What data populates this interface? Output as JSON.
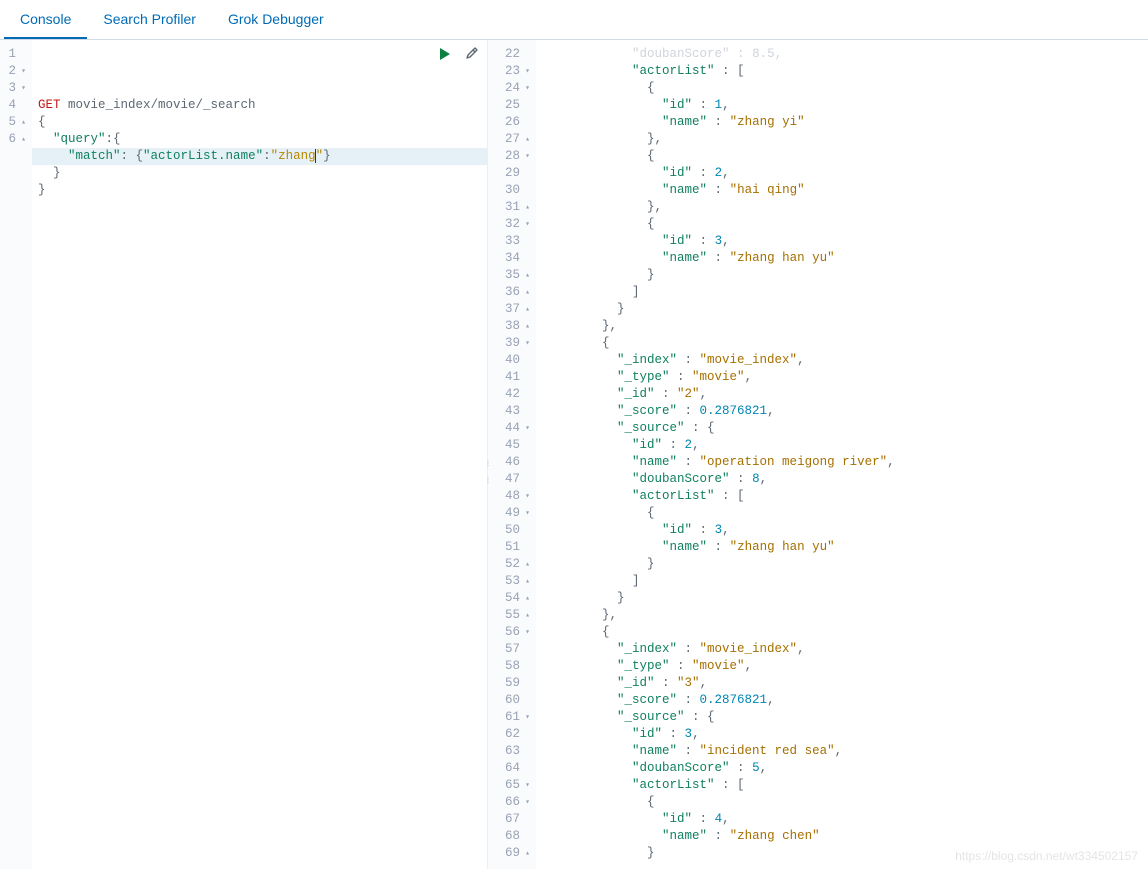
{
  "tabs": {
    "console": "Console",
    "searchProfiler": "Search Profiler",
    "grokDebugger": "Grok Debugger"
  },
  "actions": {
    "run": "play-icon",
    "tools": "wrench-icon"
  },
  "request": {
    "method": "GET",
    "path": "movie_index/movie/_search",
    "lines": [
      {
        "n": 1,
        "fold": "",
        "segs": [
          {
            "t": "GET ",
            "c": "kw"
          },
          {
            "t": "movie_index/movie/_search",
            "c": "path"
          }
        ]
      },
      {
        "n": 2,
        "fold": "▾",
        "segs": [
          {
            "t": "{",
            "c": "brace"
          }
        ]
      },
      {
        "n": 3,
        "fold": "▾",
        "segs": [
          {
            "t": "  ",
            "c": ""
          },
          {
            "t": "\"query\"",
            "c": "key"
          },
          {
            "t": ":{",
            "c": "punct"
          }
        ]
      },
      {
        "n": 4,
        "fold": "",
        "hl": true,
        "segs": [
          {
            "t": "    ",
            "c": ""
          },
          {
            "t": "\"match\"",
            "c": "key"
          },
          {
            "t": ": {",
            "c": "punct"
          },
          {
            "t": "\"actorList.name\"",
            "c": "key"
          },
          {
            "t": ":",
            "c": "punct"
          },
          {
            "t": "\"zhang",
            "c": "str"
          },
          {
            "t": "|",
            "c": "cursorchar"
          },
          {
            "t": "\"",
            "c": "str"
          },
          {
            "t": "}",
            "c": "punct"
          }
        ]
      },
      {
        "n": 5,
        "fold": "▴",
        "segs": [
          {
            "t": "  }",
            "c": "brace"
          }
        ]
      },
      {
        "n": 6,
        "fold": "▴",
        "segs": [
          {
            "t": "}",
            "c": "brace"
          }
        ]
      }
    ]
  },
  "response": {
    "lines": [
      {
        "n": 22,
        "fold": "",
        "segs": [
          {
            "t": "            ",
            "c": ""
          },
          {
            "t": "\"doubanScore\"",
            "c": "key tr"
          },
          {
            "t": " : ",
            "c": "punct tr"
          },
          {
            "t": "8.5",
            "c": "num tr"
          },
          {
            "t": ",",
            "c": "punct tr"
          }
        ],
        "truncated": true
      },
      {
        "n": 23,
        "fold": "▾",
        "segs": [
          {
            "t": "            ",
            "c": ""
          },
          {
            "t": "\"actorList\"",
            "c": "key"
          },
          {
            "t": " : [",
            "c": "punct"
          }
        ]
      },
      {
        "n": 24,
        "fold": "▾",
        "segs": [
          {
            "t": "              {",
            "c": "punct"
          }
        ]
      },
      {
        "n": 25,
        "fold": "",
        "segs": [
          {
            "t": "                ",
            "c": ""
          },
          {
            "t": "\"id\"",
            "c": "key"
          },
          {
            "t": " : ",
            "c": "punct"
          },
          {
            "t": "1",
            "c": "num"
          },
          {
            "t": ",",
            "c": "punct"
          }
        ]
      },
      {
        "n": 26,
        "fold": "",
        "segs": [
          {
            "t": "                ",
            "c": ""
          },
          {
            "t": "\"name\"",
            "c": "key"
          },
          {
            "t": " : ",
            "c": "punct"
          },
          {
            "t": "\"zhang yi\"",
            "c": "strv"
          }
        ]
      },
      {
        "n": 27,
        "fold": "▴",
        "segs": [
          {
            "t": "              },",
            "c": "punct"
          }
        ]
      },
      {
        "n": 28,
        "fold": "▾",
        "segs": [
          {
            "t": "              {",
            "c": "punct"
          }
        ]
      },
      {
        "n": 29,
        "fold": "",
        "segs": [
          {
            "t": "                ",
            "c": ""
          },
          {
            "t": "\"id\"",
            "c": "key"
          },
          {
            "t": " : ",
            "c": "punct"
          },
          {
            "t": "2",
            "c": "num"
          },
          {
            "t": ",",
            "c": "punct"
          }
        ]
      },
      {
        "n": 30,
        "fold": "",
        "segs": [
          {
            "t": "                ",
            "c": ""
          },
          {
            "t": "\"name\"",
            "c": "key"
          },
          {
            "t": " : ",
            "c": "punct"
          },
          {
            "t": "\"hai qing\"",
            "c": "strv"
          }
        ]
      },
      {
        "n": 31,
        "fold": "▴",
        "segs": [
          {
            "t": "              },",
            "c": "punct"
          }
        ]
      },
      {
        "n": 32,
        "fold": "▾",
        "segs": [
          {
            "t": "              {",
            "c": "punct"
          }
        ]
      },
      {
        "n": 33,
        "fold": "",
        "segs": [
          {
            "t": "                ",
            "c": ""
          },
          {
            "t": "\"id\"",
            "c": "key"
          },
          {
            "t": " : ",
            "c": "punct"
          },
          {
            "t": "3",
            "c": "num"
          },
          {
            "t": ",",
            "c": "punct"
          }
        ]
      },
      {
        "n": 34,
        "fold": "",
        "segs": [
          {
            "t": "                ",
            "c": ""
          },
          {
            "t": "\"name\"",
            "c": "key"
          },
          {
            "t": " : ",
            "c": "punct"
          },
          {
            "t": "\"zhang han yu\"",
            "c": "strv"
          }
        ]
      },
      {
        "n": 35,
        "fold": "▴",
        "segs": [
          {
            "t": "              }",
            "c": "punct"
          }
        ]
      },
      {
        "n": 36,
        "fold": "▴",
        "segs": [
          {
            "t": "            ]",
            "c": "punct"
          }
        ]
      },
      {
        "n": 37,
        "fold": "▴",
        "segs": [
          {
            "t": "          }",
            "c": "punct"
          }
        ]
      },
      {
        "n": 38,
        "fold": "▴",
        "segs": [
          {
            "t": "        },",
            "c": "punct"
          }
        ]
      },
      {
        "n": 39,
        "fold": "▾",
        "segs": [
          {
            "t": "        {",
            "c": "punct"
          }
        ]
      },
      {
        "n": 40,
        "fold": "",
        "segs": [
          {
            "t": "          ",
            "c": ""
          },
          {
            "t": "\"_index\"",
            "c": "key"
          },
          {
            "t": " : ",
            "c": "punct"
          },
          {
            "t": "\"movie_index\"",
            "c": "strv"
          },
          {
            "t": ",",
            "c": "punct"
          }
        ]
      },
      {
        "n": 41,
        "fold": "",
        "segs": [
          {
            "t": "          ",
            "c": ""
          },
          {
            "t": "\"_type\"",
            "c": "key"
          },
          {
            "t": " : ",
            "c": "punct"
          },
          {
            "t": "\"movie\"",
            "c": "strv"
          },
          {
            "t": ",",
            "c": "punct"
          }
        ]
      },
      {
        "n": 42,
        "fold": "",
        "segs": [
          {
            "t": "          ",
            "c": ""
          },
          {
            "t": "\"_id\"",
            "c": "key"
          },
          {
            "t": " : ",
            "c": "punct"
          },
          {
            "t": "\"2\"",
            "c": "strv"
          },
          {
            "t": ",",
            "c": "punct"
          }
        ]
      },
      {
        "n": 43,
        "fold": "",
        "segs": [
          {
            "t": "          ",
            "c": ""
          },
          {
            "t": "\"_score\"",
            "c": "key"
          },
          {
            "t": " : ",
            "c": "punct"
          },
          {
            "t": "0.2876821",
            "c": "num"
          },
          {
            "t": ",",
            "c": "punct"
          }
        ]
      },
      {
        "n": 44,
        "fold": "▾",
        "segs": [
          {
            "t": "          ",
            "c": ""
          },
          {
            "t": "\"_source\"",
            "c": "key"
          },
          {
            "t": " : {",
            "c": "punct"
          }
        ]
      },
      {
        "n": 45,
        "fold": "",
        "segs": [
          {
            "t": "            ",
            "c": ""
          },
          {
            "t": "\"id\"",
            "c": "key"
          },
          {
            "t": " : ",
            "c": "punct"
          },
          {
            "t": "2",
            "c": "num"
          },
          {
            "t": ",",
            "c": "punct"
          }
        ]
      },
      {
        "n": 46,
        "fold": "",
        "segs": [
          {
            "t": "            ",
            "c": ""
          },
          {
            "t": "\"name\"",
            "c": "key"
          },
          {
            "t": " : ",
            "c": "punct"
          },
          {
            "t": "\"operation meigong river\"",
            "c": "strv"
          },
          {
            "t": ",",
            "c": "punct"
          }
        ]
      },
      {
        "n": 47,
        "fold": "",
        "segs": [
          {
            "t": "            ",
            "c": ""
          },
          {
            "t": "\"doubanScore\"",
            "c": "key"
          },
          {
            "t": " : ",
            "c": "punct"
          },
          {
            "t": "8",
            "c": "num"
          },
          {
            "t": ",",
            "c": "punct"
          }
        ]
      },
      {
        "n": 48,
        "fold": "▾",
        "segs": [
          {
            "t": "            ",
            "c": ""
          },
          {
            "t": "\"actorList\"",
            "c": "key"
          },
          {
            "t": " : [",
            "c": "punct"
          }
        ]
      },
      {
        "n": 49,
        "fold": "▾",
        "segs": [
          {
            "t": "              {",
            "c": "punct"
          }
        ]
      },
      {
        "n": 50,
        "fold": "",
        "segs": [
          {
            "t": "                ",
            "c": ""
          },
          {
            "t": "\"id\"",
            "c": "key"
          },
          {
            "t": " : ",
            "c": "punct"
          },
          {
            "t": "3",
            "c": "num"
          },
          {
            "t": ",",
            "c": "punct"
          }
        ]
      },
      {
        "n": 51,
        "fold": "",
        "segs": [
          {
            "t": "                ",
            "c": ""
          },
          {
            "t": "\"name\"",
            "c": "key"
          },
          {
            "t": " : ",
            "c": "punct"
          },
          {
            "t": "\"zhang han yu\"",
            "c": "strv"
          }
        ]
      },
      {
        "n": 52,
        "fold": "▴",
        "segs": [
          {
            "t": "              }",
            "c": "punct"
          }
        ]
      },
      {
        "n": 53,
        "fold": "▴",
        "segs": [
          {
            "t": "            ]",
            "c": "punct"
          }
        ]
      },
      {
        "n": 54,
        "fold": "▴",
        "segs": [
          {
            "t": "          }",
            "c": "punct"
          }
        ]
      },
      {
        "n": 55,
        "fold": "▴",
        "segs": [
          {
            "t": "        },",
            "c": "punct"
          }
        ]
      },
      {
        "n": 56,
        "fold": "▾",
        "segs": [
          {
            "t": "        {",
            "c": "punct"
          }
        ]
      },
      {
        "n": 57,
        "fold": "",
        "segs": [
          {
            "t": "          ",
            "c": ""
          },
          {
            "t": "\"_index\"",
            "c": "key"
          },
          {
            "t": " : ",
            "c": "punct"
          },
          {
            "t": "\"movie_index\"",
            "c": "strv"
          },
          {
            "t": ",",
            "c": "punct"
          }
        ]
      },
      {
        "n": 58,
        "fold": "",
        "segs": [
          {
            "t": "          ",
            "c": ""
          },
          {
            "t": "\"_type\"",
            "c": "key"
          },
          {
            "t": " : ",
            "c": "punct"
          },
          {
            "t": "\"movie\"",
            "c": "strv"
          },
          {
            "t": ",",
            "c": "punct"
          }
        ]
      },
      {
        "n": 59,
        "fold": "",
        "segs": [
          {
            "t": "          ",
            "c": ""
          },
          {
            "t": "\"_id\"",
            "c": "key"
          },
          {
            "t": " : ",
            "c": "punct"
          },
          {
            "t": "\"3\"",
            "c": "strv"
          },
          {
            "t": ",",
            "c": "punct"
          }
        ]
      },
      {
        "n": 60,
        "fold": "",
        "segs": [
          {
            "t": "          ",
            "c": ""
          },
          {
            "t": "\"_score\"",
            "c": "key"
          },
          {
            "t": " : ",
            "c": "punct"
          },
          {
            "t": "0.2876821",
            "c": "num"
          },
          {
            "t": ",",
            "c": "punct"
          }
        ]
      },
      {
        "n": 61,
        "fold": "▾",
        "segs": [
          {
            "t": "          ",
            "c": ""
          },
          {
            "t": "\"_source\"",
            "c": "key"
          },
          {
            "t": " : {",
            "c": "punct"
          }
        ]
      },
      {
        "n": 62,
        "fold": "",
        "segs": [
          {
            "t": "            ",
            "c": ""
          },
          {
            "t": "\"id\"",
            "c": "key"
          },
          {
            "t": " : ",
            "c": "punct"
          },
          {
            "t": "3",
            "c": "num"
          },
          {
            "t": ",",
            "c": "punct"
          }
        ]
      },
      {
        "n": 63,
        "fold": "",
        "segs": [
          {
            "t": "            ",
            "c": ""
          },
          {
            "t": "\"name\"",
            "c": "key"
          },
          {
            "t": " : ",
            "c": "punct"
          },
          {
            "t": "\"incident red sea\"",
            "c": "strv"
          },
          {
            "t": ",",
            "c": "punct"
          }
        ]
      },
      {
        "n": 64,
        "fold": "",
        "segs": [
          {
            "t": "            ",
            "c": ""
          },
          {
            "t": "\"doubanScore\"",
            "c": "key"
          },
          {
            "t": " : ",
            "c": "punct"
          },
          {
            "t": "5",
            "c": "num"
          },
          {
            "t": ",",
            "c": "punct"
          }
        ]
      },
      {
        "n": 65,
        "fold": "▾",
        "segs": [
          {
            "t": "            ",
            "c": ""
          },
          {
            "t": "\"actorList\"",
            "c": "key"
          },
          {
            "t": " : [",
            "c": "punct"
          }
        ]
      },
      {
        "n": 66,
        "fold": "▾",
        "segs": [
          {
            "t": "              {",
            "c": "punct"
          }
        ]
      },
      {
        "n": 67,
        "fold": "",
        "segs": [
          {
            "t": "                ",
            "c": ""
          },
          {
            "t": "\"id\"",
            "c": "key"
          },
          {
            "t": " : ",
            "c": "punct"
          },
          {
            "t": "4",
            "c": "num"
          },
          {
            "t": ",",
            "c": "punct"
          }
        ]
      },
      {
        "n": 68,
        "fold": "",
        "segs": [
          {
            "t": "                ",
            "c": ""
          },
          {
            "t": "\"name\"",
            "c": "key"
          },
          {
            "t": " : ",
            "c": "punct"
          },
          {
            "t": "\"zhang chen\"",
            "c": "strv"
          }
        ]
      },
      {
        "n": 69,
        "fold": "▴",
        "segs": [
          {
            "t": "              }",
            "c": "punct"
          }
        ]
      }
    ]
  },
  "watermark": "https://blog.csdn.net/wt334502157"
}
